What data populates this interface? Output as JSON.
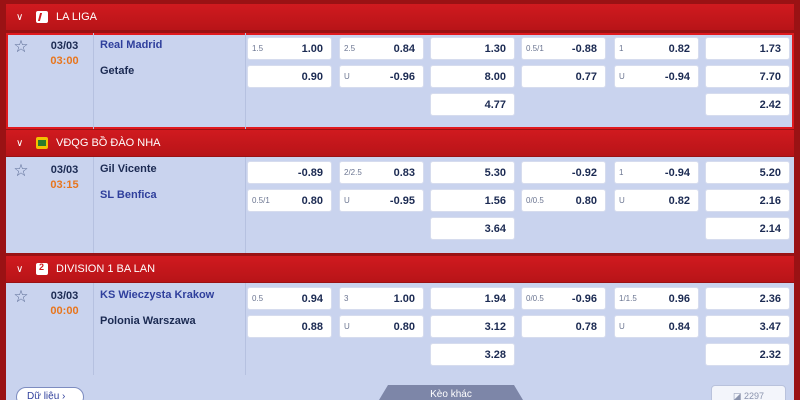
{
  "leagues": [
    {
      "name": "LA LIGA",
      "match": {
        "date": "03/03",
        "time": "03:00",
        "home": "Real Madrid",
        "away": "Getafe",
        "odds": {
          "r0": [
            {
              "hc": "1.5",
              "v": "1.00"
            },
            {
              "hc": "2.5",
              "v": "0.84"
            },
            {
              "hc": "",
              "v": "1.30"
            },
            {
              "hc": "0.5/1",
              "v": "-0.88"
            },
            {
              "hc": "1",
              "v": "0.82"
            },
            {
              "hc": "",
              "v": "1.73"
            }
          ],
          "r1": [
            {
              "hc": "",
              "v": "0.90"
            },
            {
              "hc": "U",
              "v": "-0.96"
            },
            {
              "hc": "",
              "v": "8.00"
            },
            {
              "hc": "",
              "v": "0.77"
            },
            {
              "hc": "U",
              "v": "-0.94"
            },
            {
              "hc": "",
              "v": "7.70"
            }
          ],
          "r2": [
            {
              "hc": "",
              "v": "4.77"
            },
            {
              "hc": "",
              "v": "2.42"
            }
          ]
        }
      }
    },
    {
      "name": "VĐQG BỒ ĐÀO NHA",
      "match": {
        "date": "03/03",
        "time": "03:15",
        "home": "Gil Vicente",
        "away": "SL Benfica",
        "odds": {
          "r0": [
            {
              "hc": "",
              "v": "-0.89"
            },
            {
              "hc": "2/2.5",
              "v": "0.83"
            },
            {
              "hc": "",
              "v": "5.30"
            },
            {
              "hc": "",
              "v": "-0.92"
            },
            {
              "hc": "1",
              "v": "-0.94"
            },
            {
              "hc": "",
              "v": "5.20"
            }
          ],
          "r1": [
            {
              "hc": "0.5/1",
              "v": "0.80"
            },
            {
              "hc": "U",
              "v": "-0.95"
            },
            {
              "hc": "",
              "v": "1.56"
            },
            {
              "hc": "0/0.5",
              "v": "0.80"
            },
            {
              "hc": "U",
              "v": "0.82"
            },
            {
              "hc": "",
              "v": "2.16"
            }
          ],
          "r2": [
            {
              "hc": "",
              "v": "3.64"
            },
            {
              "hc": "",
              "v": "2.14"
            }
          ]
        }
      }
    },
    {
      "name": "DIVISION 1 BA LAN",
      "match": {
        "date": "03/03",
        "time": "00:00",
        "home": "KS Wieczysta Krakow",
        "away": "Polonia Warszawa",
        "odds": {
          "r0": [
            {
              "hc": "0.5",
              "v": "0.94"
            },
            {
              "hc": "3",
              "v": "1.00"
            },
            {
              "hc": "",
              "v": "1.94"
            },
            {
              "hc": "0/0.5",
              "v": "-0.96"
            },
            {
              "hc": "1/1.5",
              "v": "0.96"
            },
            {
              "hc": "",
              "v": "2.36"
            }
          ],
          "r1": [
            {
              "hc": "",
              "v": "0.88"
            },
            {
              "hc": "U",
              "v": "0.80"
            },
            {
              "hc": "",
              "v": "3.12"
            },
            {
              "hc": "",
              "v": "0.78"
            },
            {
              "hc": "U",
              "v": "0.84"
            },
            {
              "hc": "",
              "v": "3.47"
            }
          ],
          "r2": [
            {
              "hc": "",
              "v": "3.28"
            },
            {
              "hc": "",
              "v": "2.32"
            }
          ]
        }
      }
    }
  ],
  "footer": {
    "data_label": "Dữ liệu",
    "more_label": "Kèo khác",
    "count": "2297"
  }
}
